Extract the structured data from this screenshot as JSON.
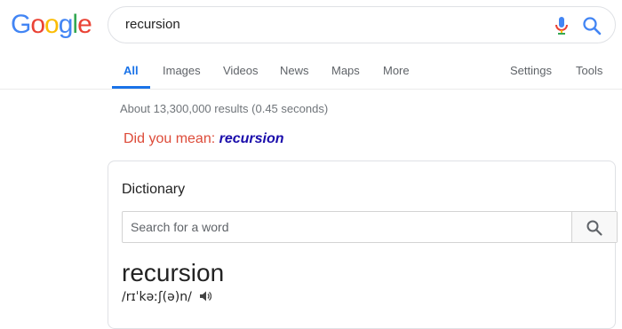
{
  "logo": {
    "letters": [
      "G",
      "o",
      "o",
      "g",
      "l",
      "e"
    ],
    "colors": [
      "#4285f4",
      "#ea4335",
      "#fbbc05",
      "#4285f4",
      "#34a853",
      "#ea4335"
    ]
  },
  "search": {
    "query": "recursion",
    "mic_icon": "mic-icon",
    "search_icon": "search-icon"
  },
  "tabs": [
    {
      "label": "All",
      "active": true
    },
    {
      "label": "Images"
    },
    {
      "label": "Videos"
    },
    {
      "label": "News"
    },
    {
      "label": "Maps"
    },
    {
      "label": "More"
    },
    {
      "label": "Settings"
    },
    {
      "label": "Tools"
    }
  ],
  "results_stats": "About 13,300,000 results (0.45 seconds)",
  "did_you_mean": {
    "prefix": "Did you mean:",
    "suggestion": "recursion"
  },
  "dictionary": {
    "title": "Dictionary",
    "search_placeholder": "Search for a word",
    "headword": "recursion",
    "pronunciation": "/rɪˈkəːʃ(ə)n/",
    "speaker_icon": "speaker-icon"
  },
  "colors": {
    "accent": "#1a73e8",
    "link": "#1a0dab",
    "did_you_mean": "#dd4b39"
  }
}
